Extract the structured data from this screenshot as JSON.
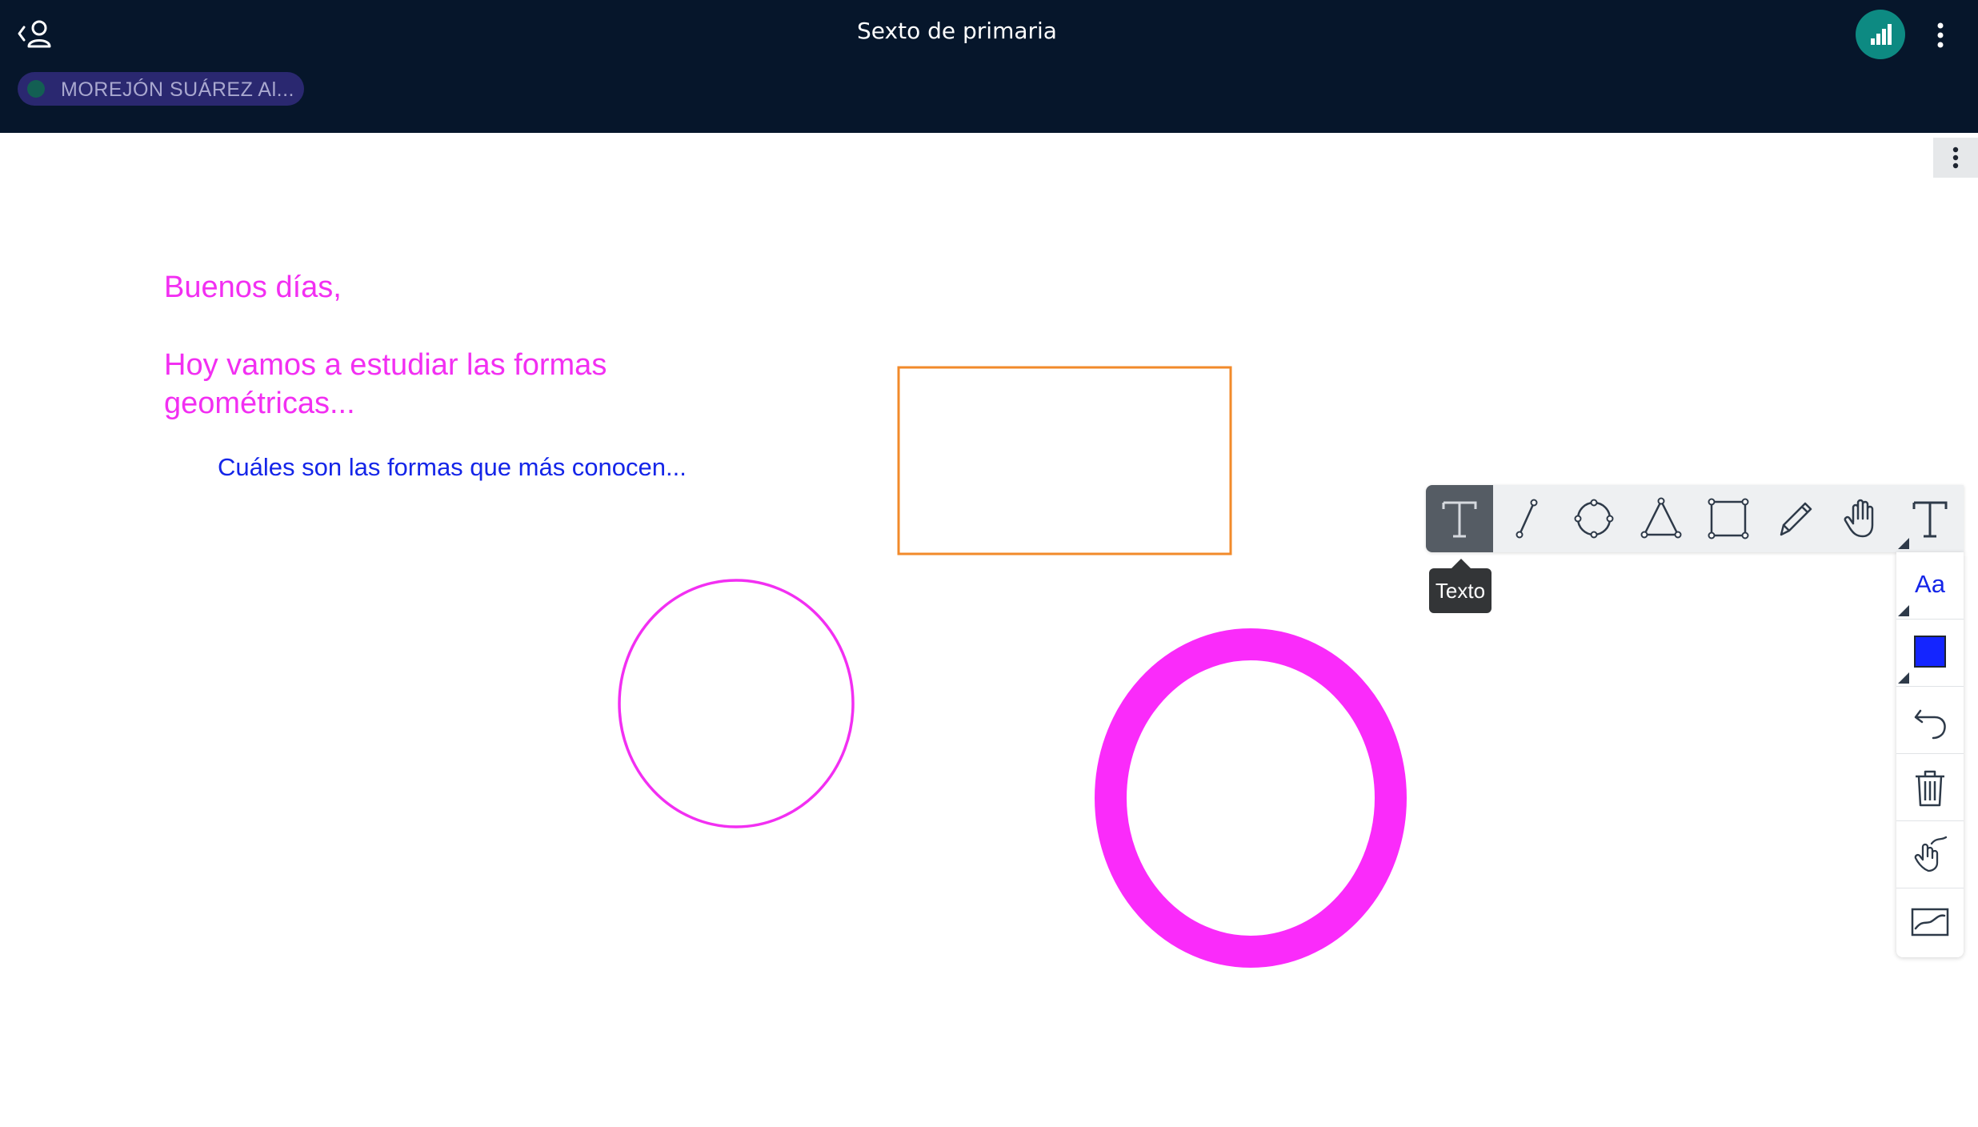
{
  "header": {
    "title": "Sexto de primaria",
    "presenter": "MOREJÓN SUÁREZ Al...",
    "icons": {
      "back": "back-user-icon",
      "signal": "connection-signal-icon",
      "menu": "more-vertical-icon"
    }
  },
  "canvas": {
    "greeting": "Buenos días,",
    "intro": "Hoy vamos a estudiar las formas geométricas...",
    "question": "Cuáles son las formas que más conocen...",
    "colors": {
      "pink": "#f22ff2",
      "blue": "#1425e8",
      "orange": "#f28a2a"
    }
  },
  "toolbar": {
    "tooltip": "Texto",
    "tools": [
      "text",
      "line",
      "ellipse",
      "triangle",
      "rectangle",
      "pencil",
      "pan",
      "text-size"
    ],
    "font_label": "Aa",
    "current_color": "#1425ff",
    "side_buttons": [
      "font",
      "color",
      "undo",
      "clear-all",
      "multi-user",
      "smooth"
    ]
  }
}
